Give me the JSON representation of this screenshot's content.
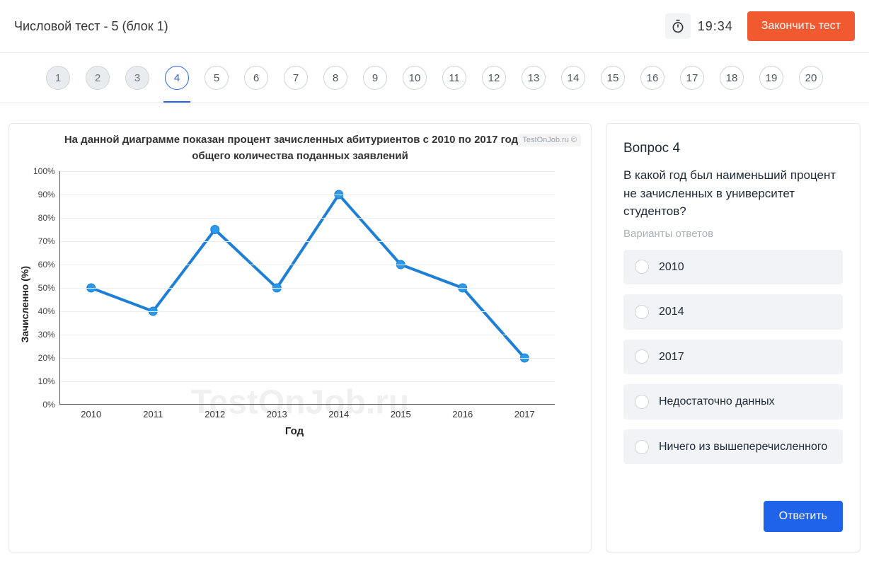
{
  "header": {
    "title": "Числовой тест - 5 (блок 1)",
    "timer": "19:34",
    "finish_label": "Закончить тест"
  },
  "nav": {
    "items": [
      "1",
      "2",
      "3",
      "4",
      "5",
      "6",
      "7",
      "8",
      "9",
      "10",
      "11",
      "12",
      "13",
      "14",
      "15",
      "16",
      "17",
      "18",
      "19",
      "20"
    ],
    "visited": [
      0,
      1,
      2
    ],
    "active": 3
  },
  "chart_data": {
    "type": "line",
    "title": "На данной диаграмме показан процент зачисленных абитуриентов с 2010 по 2017 год, из общего количества поданных заявлений",
    "xlabel": "Год",
    "ylabel": "Зачисленно (%)",
    "categories": [
      "2010",
      "2011",
      "2012",
      "2013",
      "2014",
      "2015",
      "2016",
      "2017"
    ],
    "values": [
      50,
      40,
      75,
      50,
      90,
      60,
      50,
      20
    ],
    "yticks": [
      100,
      90,
      80,
      70,
      60,
      50,
      40,
      30,
      20,
      10,
      0
    ],
    "ylim": [
      0,
      100
    ],
    "watermark_small": "TestOnJob.ru ©",
    "watermark_big": "TestOnJob.ru"
  },
  "question": {
    "heading": "Вопрос 4",
    "text": "В какой год был наименьший процент не зачисленных в университет студентов?",
    "answers_label": "Варианты ответов",
    "options": [
      "2010",
      "2014",
      "2017",
      "Недостаточно данных",
      "Ничего из вышеперечисленного"
    ],
    "submit_label": "Ответить"
  }
}
